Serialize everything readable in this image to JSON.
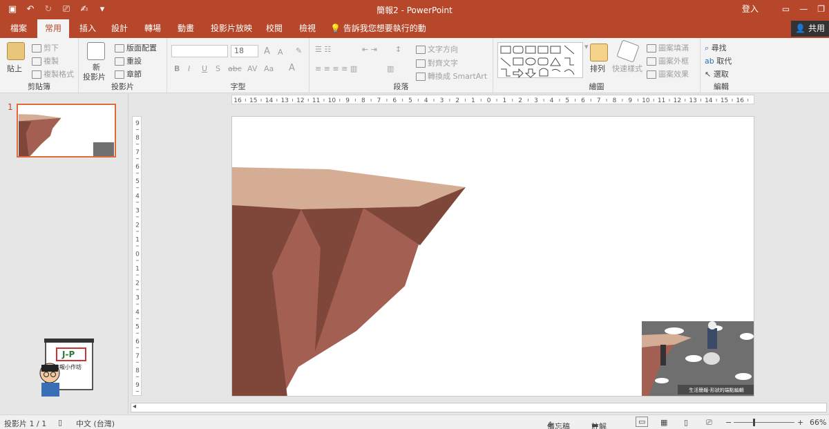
{
  "window": {
    "title": "簡報2 - PowerPoint",
    "signin": "登入",
    "share": "共用"
  },
  "tabs": [
    "檔案",
    "常用",
    "插入",
    "設計",
    "轉場",
    "動畫",
    "投影片放映",
    "校閱",
    "檢視"
  ],
  "tell_me": "告訴我您想要執行的動作",
  "ribbon": {
    "clipboard": {
      "label": "剪貼簿",
      "paste": "貼上",
      "cut": "剪下",
      "copy": "複製",
      "format_painter": "複製格式"
    },
    "slides": {
      "label": "投影片",
      "new_slide_1": "新",
      "new_slide_2": "投影片",
      "layout": "版面配置",
      "reset": "重設",
      "section": "章節"
    },
    "font": {
      "label": "字型",
      "font_size": "18",
      "bold": "B",
      "italic": "I",
      "underline": "U",
      "shadow": "S",
      "strike": "abc",
      "spacing": "AV",
      "case": "Aa",
      "color": "A",
      "grow": "A",
      "shrink": "A"
    },
    "paragraph": {
      "label": "段落",
      "text_direction": "文字方向",
      "align_text": "對齊文字",
      "smartart": "轉換成 SmartArt"
    },
    "drawing": {
      "label": "繪圖",
      "arrange": "排列",
      "quick_styles": "快速樣式",
      "shape_fill": "圖案填滿",
      "shape_outline": "圖案外框",
      "shape_effects": "圖案效果"
    },
    "editing": {
      "label": "編輯",
      "find": "尋找",
      "replace": "取代",
      "select": "選取"
    }
  },
  "thumbnail": {
    "number": "1"
  },
  "slide": {
    "caption": "生活簡報-形狀的端點編輯",
    "logo_text_1": "J-P",
    "logo_text_2": "簡報小作坊"
  },
  "ruler": {
    "horizontal": [
      "16",
      "15",
      "14",
      "13",
      "12",
      "11",
      "10",
      "9",
      "8",
      "7",
      "6",
      "5",
      "4",
      "3",
      "2",
      "1",
      "0",
      "1",
      "2",
      "3",
      "4",
      "5",
      "6",
      "7",
      "8",
      "9",
      "10",
      "11",
      "12",
      "13",
      "14",
      "15",
      "16"
    ],
    "vertical": [
      "9",
      "8",
      "7",
      "6",
      "5",
      "4",
      "3",
      "2",
      "1",
      "0",
      "1",
      "2",
      "3",
      "4",
      "5",
      "6",
      "7",
      "8",
      "9"
    ]
  },
  "status": {
    "slide_count": "投影片 1 / 1",
    "language": "中文 (台灣)",
    "notes": "備忘稿",
    "comments": "註解",
    "zoom": "66%"
  },
  "colors": {
    "accent": "#b7472a",
    "cliff_top": "#d4ad94",
    "cliff_dark": "#7f463a",
    "cliff_mid": "#a35f52"
  }
}
